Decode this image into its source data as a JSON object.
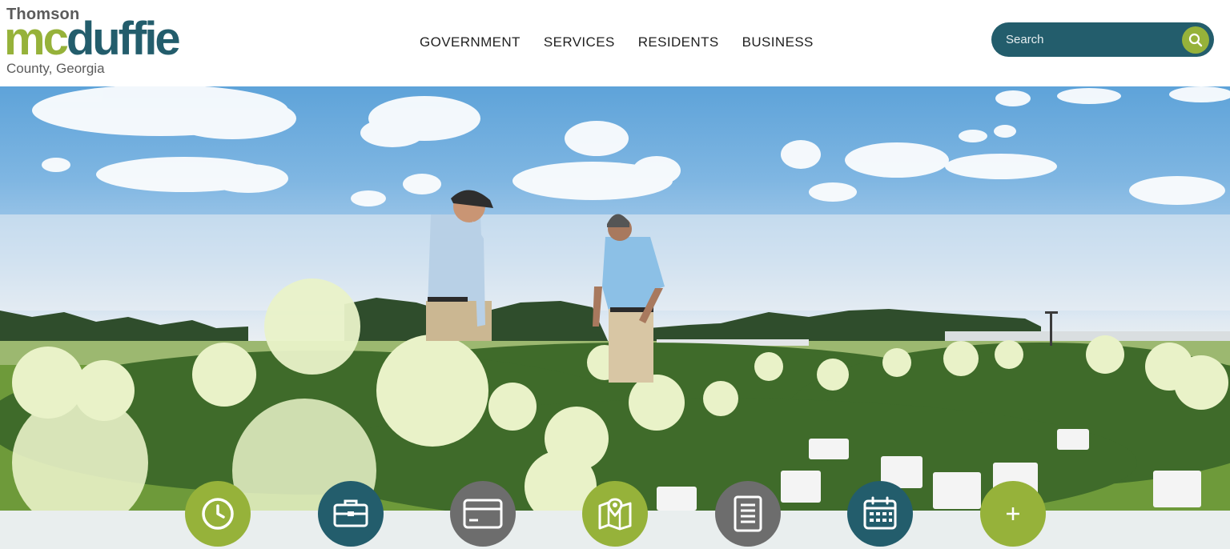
{
  "logo": {
    "top_text": "Thomson",
    "main_text_part1": "mc",
    "main_text_part2": "duffie",
    "bottom_text": "County, Georgia"
  },
  "nav": {
    "items": [
      {
        "label": "GOVERNMENT"
      },
      {
        "label": "SERVICES"
      },
      {
        "label": "RESIDENTS"
      },
      {
        "label": "BUSINESS"
      }
    ]
  },
  "search": {
    "placeholder": "Search",
    "value": ""
  },
  "colors": {
    "brand_green": "#96b23a",
    "brand_teal": "#235d6c",
    "neutral_grey": "#6d6d6d"
  },
  "quick_links": [
    {
      "icon": "clock-icon",
      "color": "green"
    },
    {
      "icon": "briefcase-icon",
      "color": "teal"
    },
    {
      "icon": "credit-card-icon",
      "color": "grey"
    },
    {
      "icon": "map-pin-icon",
      "color": "green"
    },
    {
      "icon": "document-icon",
      "color": "grey"
    },
    {
      "icon": "calendar-icon",
      "color": "teal"
    },
    {
      "icon": "plus-icon",
      "color": "green"
    }
  ]
}
